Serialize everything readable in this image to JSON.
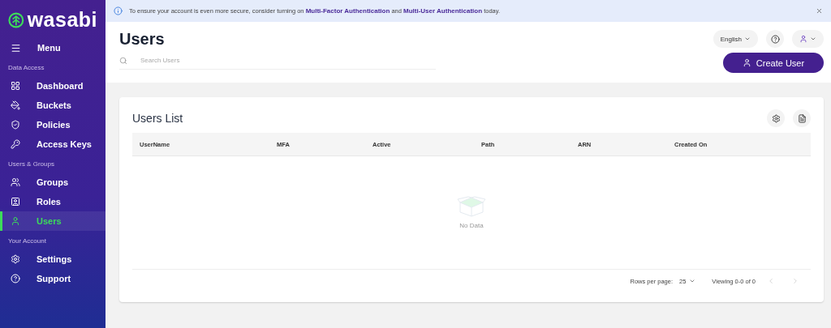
{
  "brand": {
    "name": "wasabi"
  },
  "sidebar": {
    "menu_label": "Menu",
    "sections": [
      {
        "title": "Data Access",
        "items": [
          {
            "label": "Dashboard",
            "selected": false
          },
          {
            "label": "Buckets",
            "selected": false
          },
          {
            "label": "Policies",
            "selected": false
          },
          {
            "label": "Access Keys",
            "selected": false
          }
        ]
      },
      {
        "title": "Users & Groups",
        "items": [
          {
            "label": "Groups",
            "selected": false
          },
          {
            "label": "Roles",
            "selected": false
          },
          {
            "label": "Users",
            "selected": true
          }
        ]
      },
      {
        "title": "Your Account",
        "items": [
          {
            "label": "Settings",
            "selected": false
          },
          {
            "label": "Support",
            "selected": false
          }
        ]
      }
    ]
  },
  "banner": {
    "parts": [
      {
        "kind": "text",
        "text": "To ensure your account is even more secure, consider turning on "
      },
      {
        "kind": "link",
        "text": "Multi-Factor Authentication"
      },
      {
        "kind": "text",
        "text": " and "
      },
      {
        "kind": "link",
        "text": "Multi-User Authentication"
      },
      {
        "kind": "text",
        "text": " today."
      }
    ]
  },
  "header": {
    "title": "Users",
    "search": {
      "placeholder": "Search Users"
    },
    "language": "English",
    "create_button": "Create User"
  },
  "card": {
    "title": "Users List",
    "columns": [
      "UserName",
      "MFA",
      "Active",
      "Path",
      "ARN",
      "Created On"
    ],
    "empty_text": "No Data",
    "pagination": {
      "rows_label": "Rows per page:",
      "rows_value": "25",
      "viewing": "Viewing 0-0 of 0"
    }
  }
}
